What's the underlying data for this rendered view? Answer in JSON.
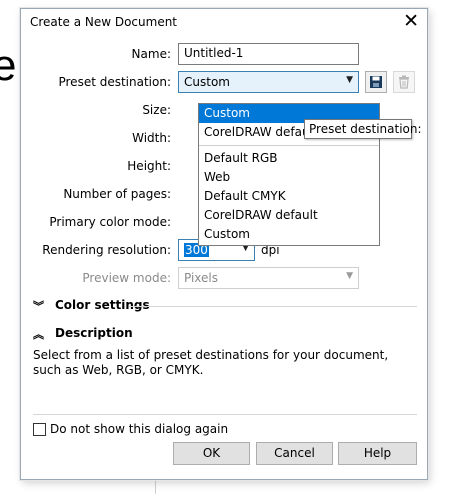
{
  "background": {
    "glyph": "e"
  },
  "dialog": {
    "title": "Create a New Document",
    "close_icon": "close-icon"
  },
  "form": {
    "name_label": "Name:",
    "name_value": "Untitled-1",
    "preset_label": "Preset destination:",
    "preset_value": "Custom",
    "size_label": "Size:",
    "width_label": "Width:",
    "height_label": "Height:",
    "pages_label": "Number of pages:",
    "color_mode_label": "Primary color mode:",
    "resolution_label": "Rendering resolution:",
    "resolution_value": "300",
    "resolution_unit": "dpi",
    "preview_label": "Preview mode:",
    "preview_value": "Pixels"
  },
  "preset_dropdown": {
    "items": [
      {
        "label": "Custom",
        "selected": true
      },
      {
        "label": "CorelDRAW default",
        "selected": false
      },
      {
        "label": "Default RGB",
        "selected": false
      },
      {
        "label": "Web",
        "selected": false
      },
      {
        "label": "Default CMYK",
        "selected": false
      },
      {
        "label": "CorelDRAW default",
        "selected": false
      },
      {
        "label": "Custom",
        "selected": false
      }
    ]
  },
  "tooltip": {
    "text": "Preset destination:"
  },
  "sections": {
    "color_settings": "Color settings",
    "description": "Description"
  },
  "description_text": "Select from a list of preset destinations for your document, such as Web, RGB, or CMYK.",
  "footer": {
    "checkbox_label": "Do not show this dialog again",
    "ok": "OK",
    "cancel": "Cancel",
    "help": "Help"
  },
  "colors": {
    "selection": "#0078d7",
    "focus_border": "#3c7fb1",
    "save_icon": "#1a3a5c"
  }
}
